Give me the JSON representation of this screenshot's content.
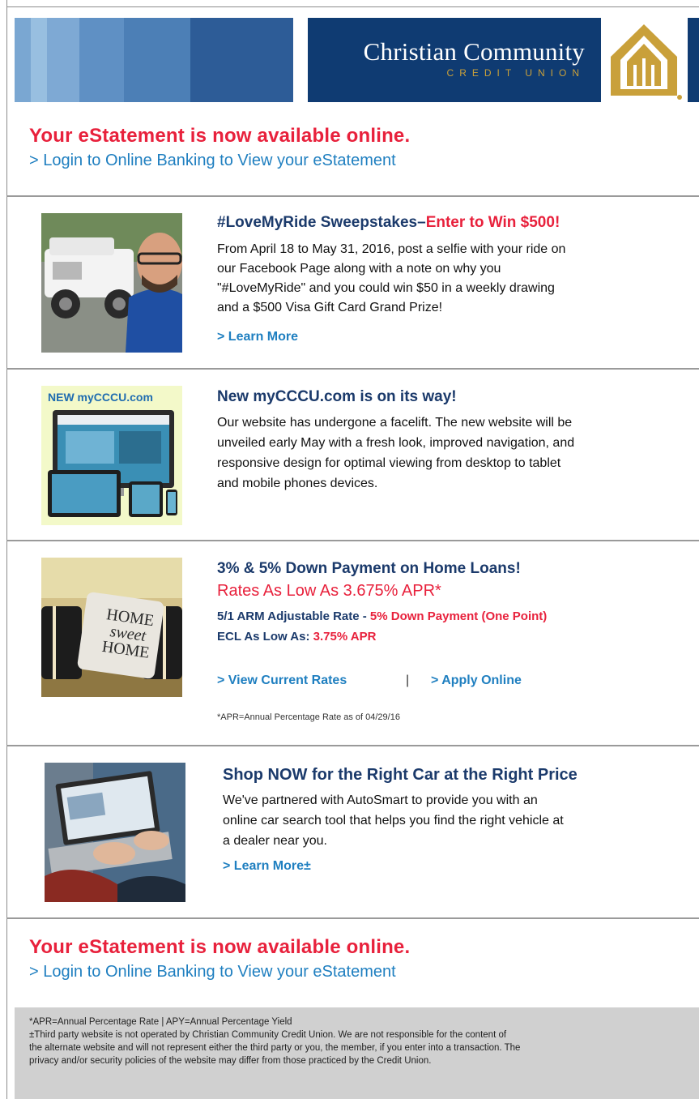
{
  "banner": {
    "brand_name": "Christian Community",
    "brand_sub": "CREDIT UNION",
    "stripe_colors": [
      "#7aa7d2",
      "#98bfe0",
      "#5f90c4",
      "#4c7fb6",
      "#3a6aa4",
      "#2d5c97"
    ],
    "brand_color": "#0f3b72",
    "gold": "#c9a03a"
  },
  "estatement_top": {
    "headline": "Your eStatement is now available online.",
    "link": "> Login to Online Banking to View your eStatement"
  },
  "sweepstakes": {
    "title": "#LoveMyRide Sweepstakes–",
    "title_red": "Enter to Win $500!",
    "lines": [
      "From April 18 to May 31, 2016, post a selfie with your ride on",
      "our Facebook Page along with a note on why you",
      "\"#LoveMyRide\" and you could win $50 in a weekly drawing",
      "and a $500 Visa Gift Card Grand Prize!"
    ],
    "link": "> Learn More"
  },
  "website": {
    "badge": "NEW myCCCU.com",
    "title": "New myCCCU.com is on its way!",
    "lines": [
      "Our website has undergone a facelift. The new website will be",
      "unveiled early May with a fresh look, improved navigation, and",
      "responsive design for optimal viewing from desktop to tablet",
      "and mobile phones devices."
    ]
  },
  "home_loans": {
    "pillow_text": [
      "HOME",
      "sweet",
      "HOME"
    ],
    "title": "3% & 5% Down Payment on Home Loans!",
    "rate_line": "Rates As Low As 3.675% APR*",
    "arm_label": "5/1 ARM Adjustable Rate - ",
    "arm_red": "5% Down Payment (One Point)",
    "ecl_label": "ECL As Low As: ",
    "ecl_red": "3.75% APR",
    "link_rates": "> View Current Rates",
    "separator": "|",
    "link_apply": "> Apply Online",
    "note": "*APR=Annual Percentage Rate as of 04/29/16"
  },
  "autosmart": {
    "title": "Shop NOW for the Right Car at the Right Price",
    "lines": [
      "We've partnered with AutoSmart to provide you with an",
      "online car search tool that helps you find the right vehicle at",
      "a dealer near you."
    ],
    "link": "> Learn More±"
  },
  "estatement_bottom": {
    "headline": "Your eStatement is now available online.",
    "link": "> Login to Online Banking to View your eStatement"
  },
  "footer": {
    "lines": [
      "*APR=Annual Percentage Rate | APY=Annual Percentage Yield",
      "±Third party website is not operated by Christian Community Credit Union. We are not responsible for the content of",
      "the alternate website and will not represent either the third party or you, the member, if you enter into a transaction. The",
      "privacy and/or security policies of the website may differ from those practiced by the Credit Union."
    ]
  }
}
